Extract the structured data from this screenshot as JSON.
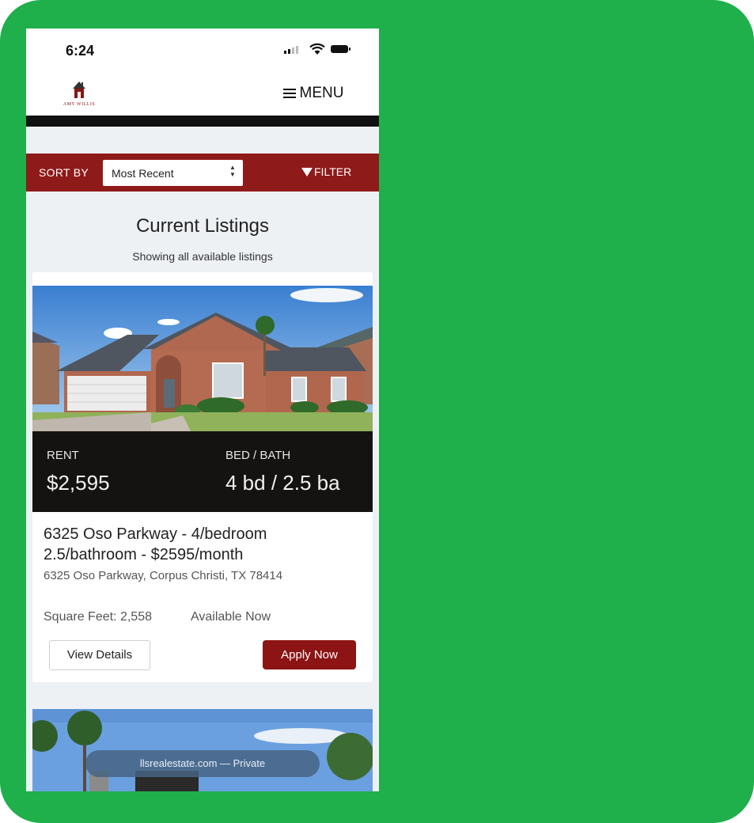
{
  "status_bar": {
    "time": "6:24"
  },
  "header": {
    "logo_text": "AMY WILLIS",
    "menu_label": "MENU"
  },
  "sort_bar": {
    "sort_label": "SORT BY",
    "sort_value": "Most Recent",
    "filter_label": "FILTER"
  },
  "page": {
    "title": "Current Listings",
    "subtitle": "Showing all available listings"
  },
  "listing": {
    "rent_label": "RENT",
    "rent_value": "$2,595",
    "bedbath_label": "BED / BATH",
    "bedbath_value": "4 bd / 2.5 ba",
    "title": "6325 Oso Parkway - 4/bedroom 2.5/bathroom - $2595/month",
    "address": "6325 Oso Parkway, Corpus Christi, TX 78414",
    "sqft": "Square Feet: 2,558",
    "availability": "Available Now",
    "view_label": "View Details",
    "apply_label": "Apply Now"
  },
  "browser": {
    "url_text": "llsrealestate.com — Private"
  },
  "colors": {
    "background": "#1faf4b",
    "brand": "#8f1a1a",
    "page_bg": "#eef1f4"
  }
}
